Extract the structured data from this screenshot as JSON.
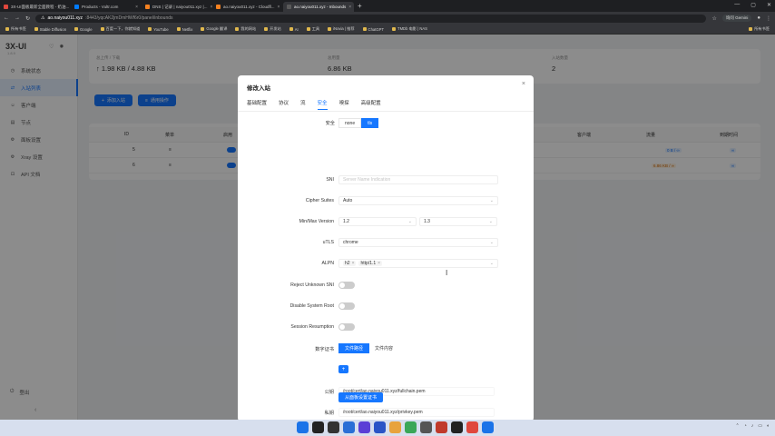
{
  "browser": {
    "tabs": [
      {
        "label": "3X-UI面板最新全面教程 - 奶油...",
        "color": "#e0473d",
        "active": false
      },
      {
        "label": "Products - Vultr.com",
        "color": "#007bfc",
        "active": false
      },
      {
        "label": "DNS | 记录 | naiyou011.xyz |...",
        "color": "#f48120",
        "active": false
      },
      {
        "label": "ao.naiyou011.xyz - Cloudfl...",
        "color": "#f48120",
        "active": false
      },
      {
        "label": "ao.naiyou011.xyz - Inbounds",
        "color": "#5a5a5a",
        "active": true
      }
    ],
    "new_tab": "+",
    "url_host": "ao.naiyou011.xyz",
    "url_path": ":8443/yqcAK2jmDmHWf6r0/panel/inbounds",
    "gemini": "询问 Gemini",
    "bookmarks": [
      "所有书签",
      "Stable Diffusion",
      "Google",
      "百度一下，你就知道",
      "YouTube",
      "Netflix",
      "Google 翻译",
      "我的网站",
      "开发站",
      "AI",
      "工具",
      "iNovia | 推荐",
      "ChatGPT",
      "TMDb 电影 | NAS",
      "所有书签"
    ]
  },
  "sidebar": {
    "brand": "3X-UI",
    "version": "1.8.9",
    "items": [
      {
        "icon": "◷",
        "label": "系统状态",
        "active": false
      },
      {
        "icon": "⇄",
        "label": "入站列表",
        "active": true
      },
      {
        "icon": "☺",
        "label": "客户端",
        "active": false
      },
      {
        "icon": "▤",
        "label": "节点",
        "active": false
      },
      {
        "icon": "⚙",
        "label": "面板设置",
        "active": false
      },
      {
        "icon": "⚙",
        "label": "Xray 设置",
        "active": false
      },
      {
        "icon": "⊡",
        "label": "API 文档",
        "active": false
      }
    ],
    "logout": "登出",
    "collapse": "‹"
  },
  "stats": {
    "traffic_label": "总上传 / 下载",
    "traffic_value": "↑ 1.98 KB / 4.88 KB",
    "usage_label": "总用量",
    "usage_value": "6.86 KB",
    "inbounds_label": "入站数量",
    "inbounds_value": "2"
  },
  "actions": {
    "add": "添加入站",
    "general": "通用操作"
  },
  "table": {
    "headers": [
      "ID",
      "菜单",
      "启用",
      "客户端",
      "流量",
      "到期时间"
    ],
    "rows": [
      {
        "id": "5",
        "menu": "≡",
        "traffic": "0 B / ∞",
        "expiry": "∞"
      },
      {
        "id": "6",
        "menu": "≡",
        "traffic": "6.86 KB / ∞",
        "expiry": "∞"
      }
    ]
  },
  "modal": {
    "title": "修改入站",
    "close": "×",
    "tabs": [
      "基础配置",
      "协议",
      "流",
      "安全",
      "嗅探",
      "高级配置"
    ],
    "active_tab": "安全",
    "security_label": "安全",
    "security_options": [
      "none",
      "tls"
    ],
    "security_selected": "tls",
    "sni_label": "SNI",
    "sni_placeholder": "Server Name Indication",
    "cipher_label": "Cipher Suites",
    "cipher_value": "Auto",
    "minmax_label": "Min/Max Version",
    "min_version": "1.2",
    "max_version": "1.3",
    "utls_label": "uTLS",
    "utls_value": "chrome",
    "alpn_label": "ALPN",
    "alpn_values": [
      "h2",
      "http/1.1"
    ],
    "reject_sni_label": "Reject Unknown SNI",
    "disable_root_label": "Disable System Root",
    "session_resumption_label": "Session Resumption",
    "cert_label": "数字证书",
    "cert_options": [
      "文件路径",
      "文件内容"
    ],
    "cert_selected": "文件路径",
    "add_cert": "+",
    "pubkey_label": "公钥",
    "pubkey_value": "/root/cert/ao.naiyou011.xyz/fullchain.pem",
    "privkey_label": "私钥",
    "privkey_value": "/root/cert/ao.naiyou011.xyz/privkey.pem",
    "from_panel_btn": "从面板设置证书"
  },
  "cursor_icon": "text-cursor-icon",
  "taskbar": {
    "tray_time": "",
    "icons": [
      "#1a73e8",
      "#222",
      "#333",
      "#2a6fd6",
      "#5b3fd6",
      "#2a54c6",
      "#e8a33d",
      "#3aa757",
      "#555",
      "#c0392b",
      "#222",
      "#e0473d",
      "#1a73e8"
    ]
  }
}
